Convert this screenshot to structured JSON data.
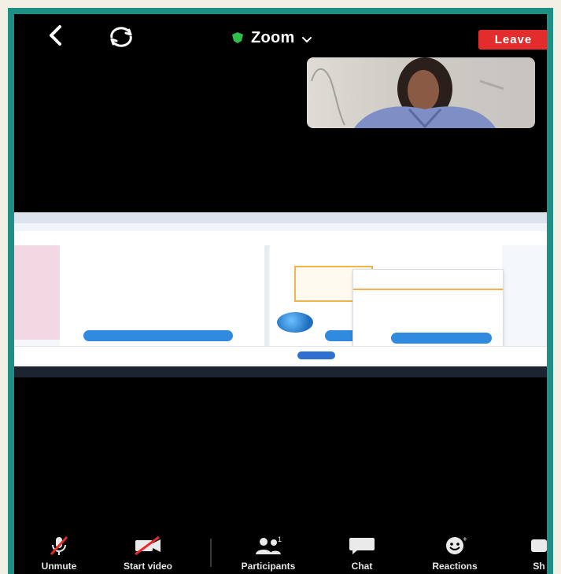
{
  "header": {
    "title": "Zoom",
    "leave_label": "Leave",
    "icons": {
      "back": "back-arrow-icon",
      "flip": "switch-camera-icon",
      "secure": "shield-icon",
      "dropdown": "chevron-down-icon"
    }
  },
  "colors": {
    "leave": "#e32d2d",
    "secure": "#2fbf4a",
    "frame": "#1f8f86"
  },
  "toolbar": {
    "items": [
      {
        "label": "Unmute",
        "icon": "mic-muted-icon"
      },
      {
        "label": "Start video",
        "icon": "video-off-icon"
      },
      {
        "label": "Participants",
        "icon": "participants-icon"
      },
      {
        "label": "Chat",
        "icon": "chat-icon"
      },
      {
        "label": "Reactions",
        "icon": "reactions-icon"
      },
      {
        "label": "Sh",
        "icon": "share-icon"
      }
    ]
  }
}
